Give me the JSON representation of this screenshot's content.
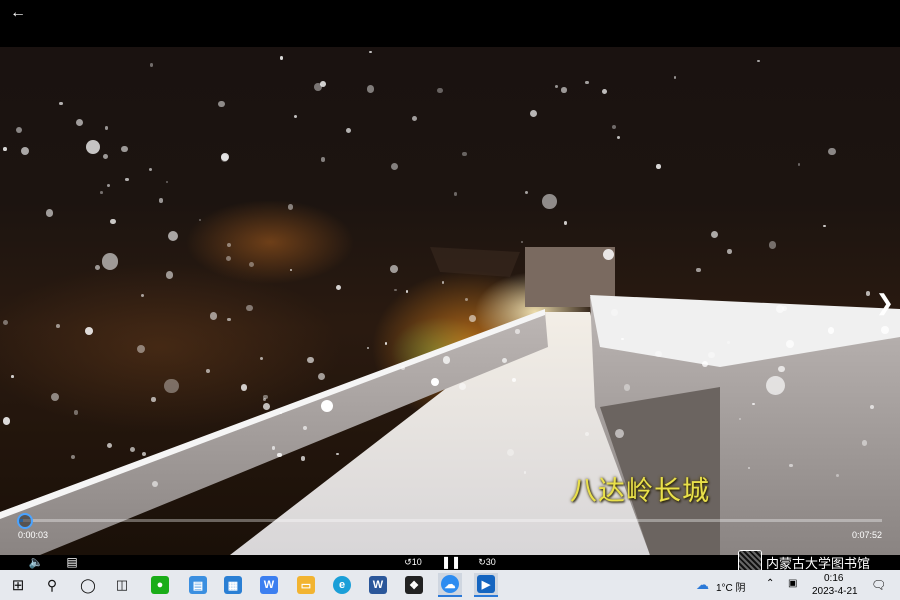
{
  "topbar": {
    "back_icon": "arrow-left-icon"
  },
  "video": {
    "caption": "八达岭长城",
    "next_icon": "chevron-right-icon"
  },
  "player": {
    "current_time": "0:00:03",
    "total_time": "0:07:52",
    "progress": 0.006,
    "skip_back_label": "10",
    "skip_forward_label": "30",
    "accent": "#4aa3ff"
  },
  "watermark": {
    "text": "内蒙古大学图书馆"
  },
  "taskbar": {
    "apps": [
      {
        "name": "start",
        "icon": "windows-icon"
      },
      {
        "name": "search",
        "icon": "search-icon"
      },
      {
        "name": "cortana",
        "icon": "circle-icon"
      },
      {
        "name": "task-view",
        "icon": "task-view-icon"
      },
      {
        "name": "wechat",
        "icon": "wechat-icon",
        "color": "#1aad19"
      },
      {
        "name": "this-pc",
        "icon": "computer-icon",
        "color": "#3b8fe0"
      },
      {
        "name": "store",
        "icon": "store-icon",
        "color": "#2a7fd4"
      },
      {
        "name": "wps",
        "icon": "wps-icon",
        "color": "#3c7ff0",
        "letter": "W"
      },
      {
        "name": "explorer",
        "icon": "folder-icon",
        "color": "#f2b431"
      },
      {
        "name": "edge",
        "icon": "edge-icon",
        "color": "#1a9fd8"
      },
      {
        "name": "word",
        "icon": "word-icon",
        "color": "#2b579a",
        "letter": "W"
      },
      {
        "name": "pdf",
        "icon": "pdf-icon",
        "color": "#222222"
      },
      {
        "name": "baidu-netdisk",
        "icon": "cloud-app-icon",
        "color": "#2d8cf0"
      },
      {
        "name": "movies",
        "icon": "play-icon",
        "color": "#1565c0"
      }
    ],
    "weather": "1°C 阴",
    "time": "0:16",
    "date": "2023-4-21",
    "weather_icon": "cloud-icon",
    "notification_icon": "chat-bubble-icon"
  }
}
